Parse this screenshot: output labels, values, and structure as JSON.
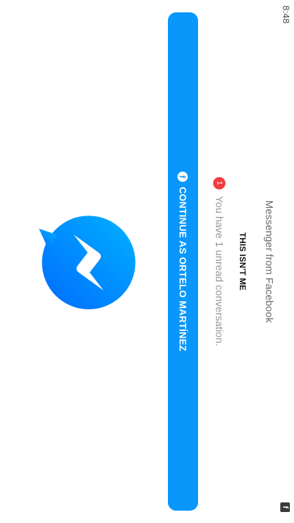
{
  "status_bar": {
    "time": "8:48",
    "app_icon": "facebook-notification-icon",
    "app_icon_glyph": "f"
  },
  "logo": {
    "icon": "messenger-logo-icon",
    "gradient_start": "#00b2ff",
    "gradient_end": "#006aff"
  },
  "login": {
    "continue_label": "CONTINUE AS ORTELO MARTÍNEZ",
    "continue_icon": "facebook-icon",
    "continue_icon_glyph": "f",
    "button_color": "#0a97fb",
    "unread_count": "1",
    "unread_text": "You have 1 unread conversation.",
    "not_me_label": "THIS ISN'T ME"
  },
  "footer": {
    "text": "Messenger from Facebook"
  }
}
